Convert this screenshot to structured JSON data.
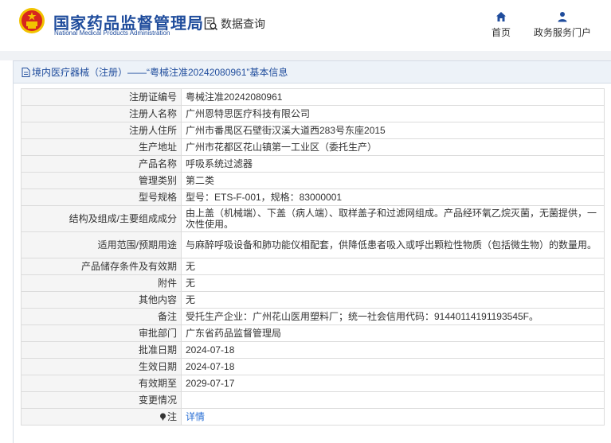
{
  "header": {
    "logo_cn": "国家药品监督管理局",
    "logo_en": "National Medical Products Administration",
    "data_query": "数据查询",
    "nav": {
      "home": "首页",
      "services": "政务服务门户"
    },
    "logo_icon": "national-emblem",
    "query_icon": "document-search-icon",
    "home_icon": "home-icon",
    "services_icon": "user-icon"
  },
  "panel": {
    "title": "境内医疗器械（注册）——“粤械注准20242080961”基本信息",
    "title_icon": "document-icon"
  },
  "rows": [
    {
      "label": "注册证编号",
      "value": "粤械注准20242080961"
    },
    {
      "label": "注册人名称",
      "value": "广州恩特思医疗科技有限公司"
    },
    {
      "label": "注册人住所",
      "value": "广州市番禺区石壁街汉溪大道西283号东座2015"
    },
    {
      "label": "生产地址",
      "value": "广州市花都区花山镇第一工业区（委托生产）"
    },
    {
      "label": "产品名称",
      "value": "呼吸系统过滤器"
    },
    {
      "label": "管理类别",
      "value": "第二类"
    },
    {
      "label": "型号规格",
      "value": "型号：ETS-F-001，规格：83000001"
    },
    {
      "label": "结构及组成/主要组成成分",
      "value": "由上盖（机械端）、下盖（病人端）、取样盖子和过滤网组成。产品经环氧乙烷灭菌，无菌提供，一次性使用。"
    },
    {
      "label": "适用范围/预期用途",
      "value": "与麻醉呼吸设备和肺功能仪相配套，供降低患者吸入或呼出颗粒性物质（包括微生物）的数量用。"
    },
    {
      "label": "产品储存条件及有效期",
      "value": "无"
    },
    {
      "label": "附件",
      "value": "无"
    },
    {
      "label": "其他内容",
      "value": "无"
    },
    {
      "label": "备注",
      "value": "受托生产企业：广州花山医用塑料厂；统一社会信用代码：91440114191193545F。"
    },
    {
      "label": "审批部门",
      "value": "广东省药品监督管理局"
    },
    {
      "label": "批准日期",
      "value": "2024-07-18"
    },
    {
      "label": "生效日期",
      "value": "2024-07-18"
    },
    {
      "label": "有效期至",
      "value": "2029-07-17"
    },
    {
      "label": "变更情况",
      "value": ""
    },
    {
      "label": "注",
      "value": "详情",
      "label_icon": "pin-icon"
    }
  ],
  "colors": {
    "brand_blue": "#1f4c9c",
    "link_blue": "#2a6fd4",
    "emblem_red": "#d7261e",
    "emblem_gold": "#f2c300"
  }
}
